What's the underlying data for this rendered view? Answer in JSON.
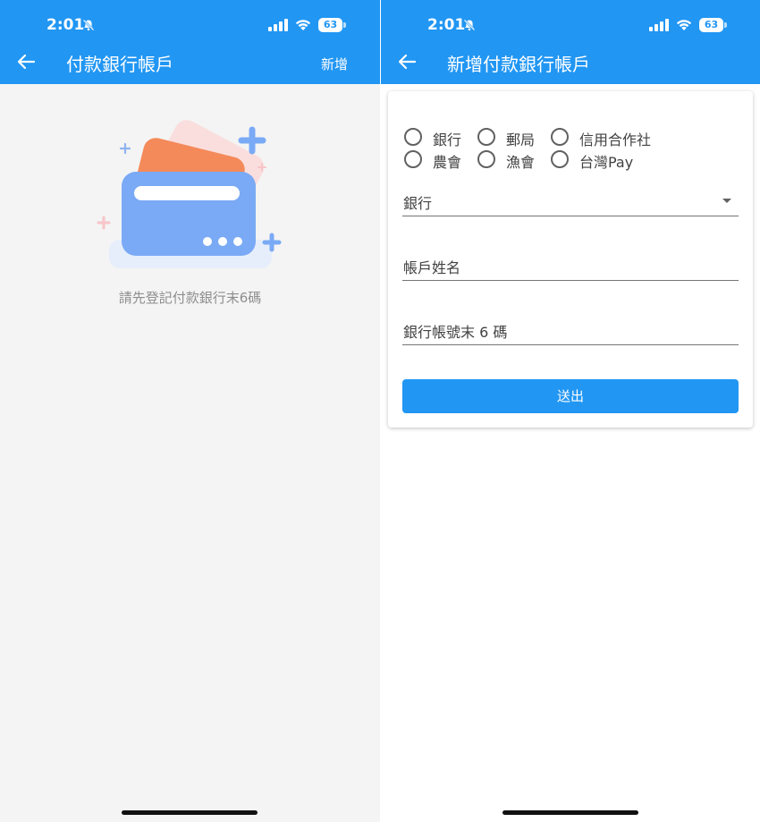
{
  "left_screen": {
    "status": {
      "time": "2:01",
      "battery": "63"
    },
    "appbar": {
      "title": "付款銀行帳戶",
      "action_label": "新增"
    },
    "empty_state": {
      "message": "請先登記付款銀行末6碼"
    }
  },
  "right_screen": {
    "status": {
      "time": "2:01",
      "battery": "63"
    },
    "appbar": {
      "title": "新增付款銀行帳戶"
    },
    "form": {
      "institution_types": [
        "銀行",
        "郵局",
        "信用合作社",
        "農會",
        "漁會",
        "台灣Pay"
      ],
      "bank_select": {
        "value": "銀行"
      },
      "account_name": {
        "placeholder": "帳戶姓名"
      },
      "account_last6": {
        "placeholder": "銀行帳號末 6 碼"
      },
      "submit_label": "送出"
    }
  },
  "colors": {
    "primary": "#2196f3",
    "illustration_blue": "#7aaaf5",
    "illustration_orange": "#f48a5a",
    "illustration_pink": "#fadede",
    "empty_text": "#8e8e8e"
  }
}
